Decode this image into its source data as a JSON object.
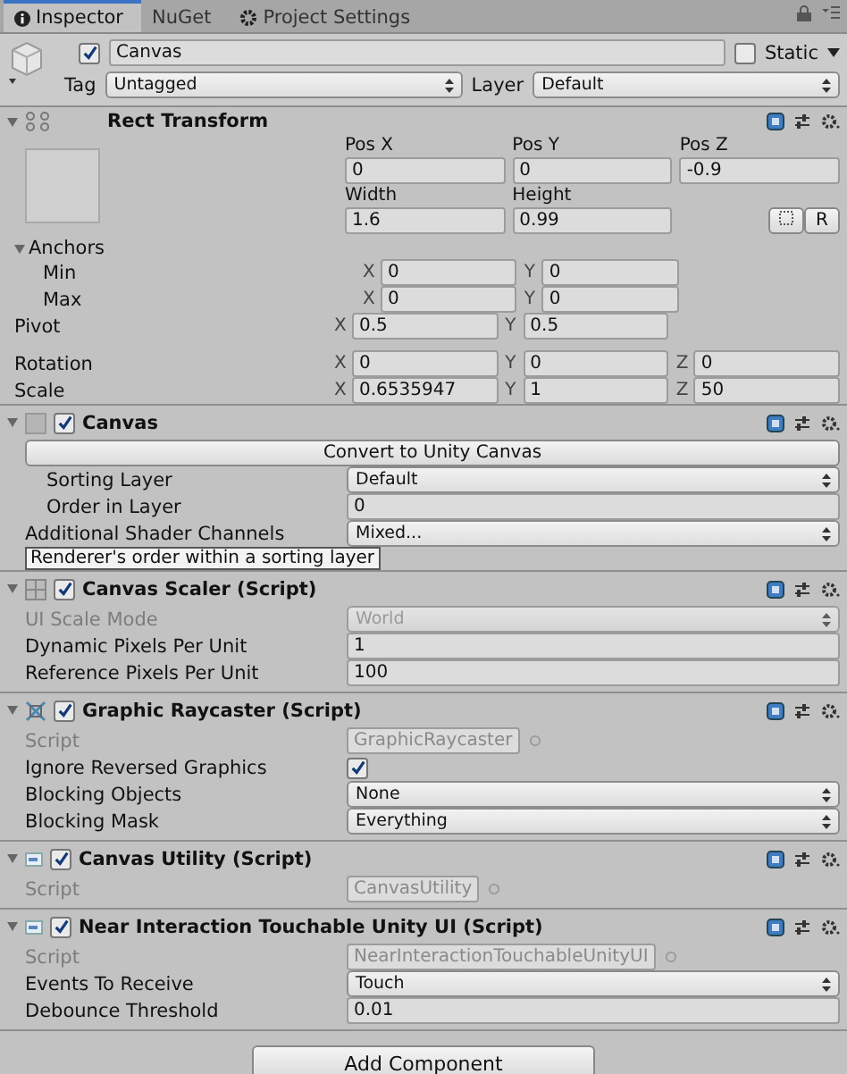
{
  "tabs": [
    {
      "label": "Inspector",
      "kind": "inspector",
      "selected": true
    },
    {
      "label": "NuGet",
      "kind": "plain",
      "selected": false
    },
    {
      "label": "Project Settings",
      "kind": "settings",
      "selected": false
    }
  ],
  "object": {
    "active": true,
    "name": "Canvas",
    "static_label": "Static",
    "static": false,
    "tag_label": "Tag",
    "tag": "Untagged",
    "layer_label": "Layer",
    "layer": "Default"
  },
  "rect_transform": {
    "title": "Rect Transform",
    "expanded": true,
    "pos_labels": [
      "Pos X",
      "Pos Y",
      "Pos Z"
    ],
    "pos_values": [
      "0",
      "0",
      "-0.9"
    ],
    "size_labels": [
      "Width",
      "Height"
    ],
    "size_values": [
      "1.6",
      "0.99"
    ],
    "reset_button": "R",
    "anchors": {
      "label": "Anchors",
      "expanded": true,
      "rows": [
        {
          "label": "Min",
          "axes": [
            {
              "axis": "X",
              "value": "0"
            },
            {
              "axis": "Y",
              "value": "0"
            }
          ]
        },
        {
          "label": "Max",
          "axes": [
            {
              "axis": "X",
              "value": "0"
            },
            {
              "axis": "Y",
              "value": "0"
            }
          ]
        }
      ]
    },
    "vectors": [
      {
        "label": "Pivot",
        "axes": [
          {
            "axis": "X",
            "value": "0.5"
          },
          {
            "axis": "Y",
            "value": "0.5"
          }
        ]
      },
      {
        "label": "Rotation",
        "axes": [
          {
            "axis": "X",
            "value": "0"
          },
          {
            "axis": "Y",
            "value": "0"
          },
          {
            "axis": "Z",
            "value": "0"
          }
        ]
      },
      {
        "label": "Scale",
        "axes": [
          {
            "axis": "X",
            "value": "0.6535947"
          },
          {
            "axis": "Y",
            "value": "1"
          },
          {
            "axis": "Z",
            "value": "50"
          }
        ]
      }
    ]
  },
  "components": [
    {
      "title": "Canvas",
      "kind": "canvas",
      "enabled": true,
      "expanded": true,
      "rows": [
        {
          "kind": "button",
          "label": "Convert to Unity Canvas",
          "disabled": false
        },
        {
          "kind": "dropdown",
          "label": "Sorting Layer",
          "value": "Default",
          "disabled": false,
          "indented": true
        },
        {
          "kind": "field",
          "label": "Order in Layer",
          "value": "0",
          "disabled": false,
          "indented": true,
          "tooltip": "Renderer's order within a sorting layer"
        },
        {
          "kind": "dropdown",
          "label": "Additional Shader Channels",
          "value": "Mixed...",
          "disabled": false,
          "indented": false
        }
      ]
    },
    {
      "title": "Canvas Scaler (Script)",
      "kind": "scaler",
      "enabled": true,
      "expanded": true,
      "rows": [
        {
          "kind": "dropdown",
          "label": "UI Scale Mode",
          "value": "World",
          "disabled": true,
          "indented": false
        },
        {
          "kind": "field",
          "label": "Dynamic Pixels Per Unit",
          "value": "1",
          "disabled": false,
          "indented": false
        },
        {
          "kind": "field",
          "label": "Reference Pixels Per Unit",
          "value": "100",
          "disabled": false,
          "indented": false
        }
      ]
    },
    {
      "title": "Graphic Raycaster (Script)",
      "kind": "raycaster",
      "enabled": true,
      "expanded": true,
      "rows": [
        {
          "kind": "object",
          "label": "Script",
          "value": "GraphicRaycaster",
          "disabled": true,
          "indented": false
        },
        {
          "kind": "checkbox",
          "label": "Ignore Reversed Graphics",
          "checked": true,
          "disabled": false,
          "indented": false
        },
        {
          "kind": "dropdown",
          "label": "Blocking Objects",
          "value": "None",
          "disabled": false,
          "indented": false
        },
        {
          "kind": "dropdown",
          "label": "Blocking Mask",
          "value": "Everything",
          "disabled": false,
          "indented": false
        }
      ]
    },
    {
      "title": "Canvas Utility (Script)",
      "kind": "script",
      "enabled": true,
      "expanded": true,
      "rows": [
        {
          "kind": "object",
          "label": "Script",
          "value": "CanvasUtility",
          "disabled": true,
          "indented": false
        }
      ]
    },
    {
      "title": "Near Interaction Touchable Unity UI (Script)",
      "kind": "script",
      "enabled": true,
      "expanded": true,
      "rows": [
        {
          "kind": "object",
          "label": "Script",
          "value": "NearInteractionTouchableUnityUI",
          "disabled": true,
          "indented": false
        },
        {
          "kind": "dropdown",
          "label": "Events To Receive",
          "value": "Touch",
          "disabled": false,
          "indented": false
        },
        {
          "kind": "field",
          "label": "Debounce Threshold",
          "value": "0.01",
          "disabled": false,
          "indented": false
        }
      ]
    }
  ],
  "add_component": "Add Component"
}
